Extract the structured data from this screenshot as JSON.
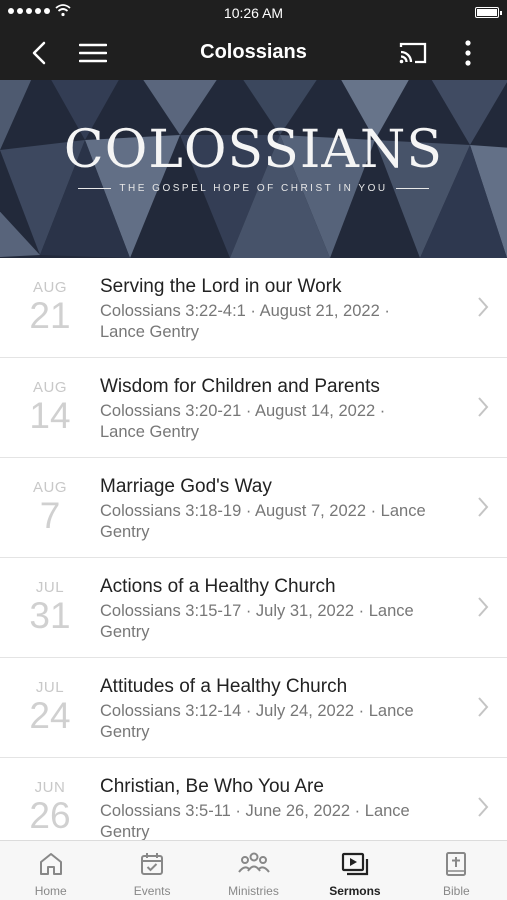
{
  "status_bar": {
    "time": "10:26 AM"
  },
  "nav": {
    "title": "Colossians"
  },
  "hero": {
    "title": "COLOSSIANS",
    "subtitle": "THE GOSPEL HOPE OF CHRIST IN YOU"
  },
  "sermons": [
    {
      "month": "AUG",
      "day": "21",
      "title": "Serving the Lord in our Work",
      "meta": "Colossians 3:22-4:1 · August 21, 2022 · Lance Gentry"
    },
    {
      "month": "AUG",
      "day": "14",
      "title": "Wisdom for Children and Parents",
      "meta": "Colossians 3:20-21 · August 14, 2022 · Lance Gentry"
    },
    {
      "month": "AUG",
      "day": "7",
      "title": "Marriage God's Way",
      "meta": "Colossians 3:18-19 · August 7, 2022 · Lance Gentry"
    },
    {
      "month": "JUL",
      "day": "31",
      "title": "Actions of a Healthy Church",
      "meta": "Colossians 3:15-17 · July 31, 2022 · Lance Gentry"
    },
    {
      "month": "JUL",
      "day": "24",
      "title": "Attitudes of a Healthy Church",
      "meta": "Colossians 3:12-14 · July 24, 2022 · Lance Gentry"
    },
    {
      "month": "JUN",
      "day": "26",
      "title": "Christian, Be Who You Are",
      "meta": "Colossians 3:5-11 · June 26, 2022 · Lance Gentry"
    }
  ],
  "tabs": [
    {
      "label": "Home",
      "icon": "home-icon"
    },
    {
      "label": "Events",
      "icon": "calendar-icon"
    },
    {
      "label": "Ministries",
      "icon": "people-icon"
    },
    {
      "label": "Sermons",
      "icon": "video-icon"
    },
    {
      "label": "Bible",
      "icon": "bible-icon"
    }
  ],
  "colors": {
    "bar_bg": "#1f1f1f",
    "hero_bg": "#2a3347",
    "muted_text": "#777777",
    "date_text": "#c8c8c8"
  }
}
